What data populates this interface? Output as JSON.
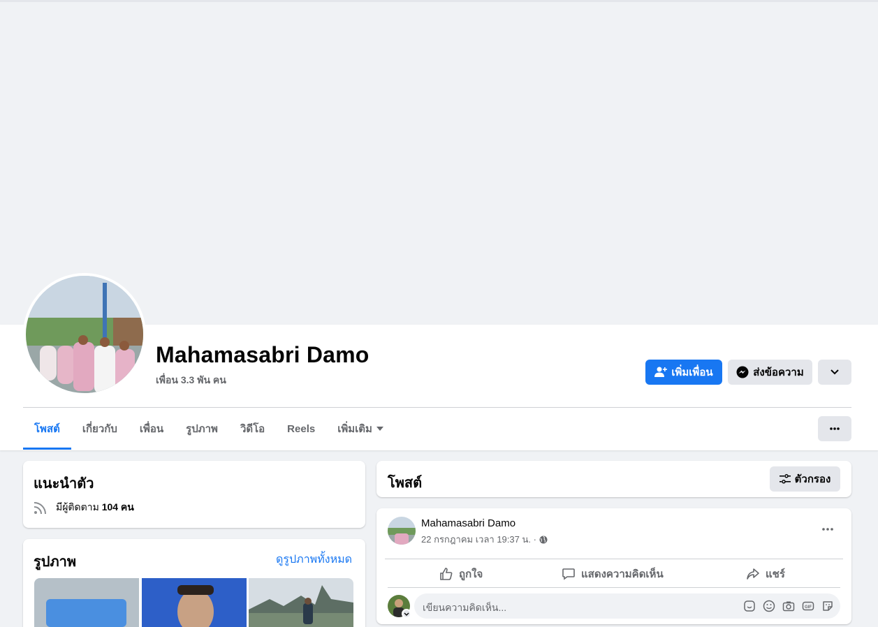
{
  "profile": {
    "name": "Mahamasabri Damo",
    "friends_count": "เพื่อน 3.3 พัน คน",
    "add_friend_label": "เพิ่มเพื่อน",
    "message_label": "ส่งข้อความ"
  },
  "tabs": [
    {
      "label": "โพสต์",
      "active": true
    },
    {
      "label": "เกี่ยวกับ"
    },
    {
      "label": "เพื่อน"
    },
    {
      "label": "รูปภาพ"
    },
    {
      "label": "วิดีโอ"
    },
    {
      "label": "Reels"
    },
    {
      "label": "เพิ่มเติม"
    }
  ],
  "intro": {
    "title": "แนะนำตัว",
    "followers_prefix": "มีผู้ติดตาม",
    "followers_count": "104 คน"
  },
  "photos": {
    "title": "รูปภาพ",
    "see_all": "ดูรูปภาพทั้งหมด"
  },
  "posts": {
    "title": "โพสต์",
    "filter_label": "ตัวกรอง"
  },
  "post": {
    "author": "Mahamasabri Damo",
    "timestamp": "22 กรกฎาคม เวลา 19:37 น. ·",
    "like_label": "ถูกใจ",
    "comment_label": "แสดงความคิดเห็น",
    "share_label": "แชร์",
    "comment_placeholder": "เขียนความคิดเห็น..."
  },
  "colors": {
    "accent": "#1877f2",
    "secondary_button": "#e4e6eb",
    "page_bg": "#f0f2f5",
    "muted_text": "#65676b"
  },
  "icons": [
    "add-friend-icon",
    "messenger-icon",
    "chevron-down-icon",
    "more-icon",
    "rss-icon",
    "filter-icon",
    "globe-icon",
    "like-icon",
    "comment-icon",
    "share-icon",
    "sticker-icon",
    "emoji-icon",
    "camera-icon",
    "gif-icon",
    "avatar-sticker-icon"
  ]
}
